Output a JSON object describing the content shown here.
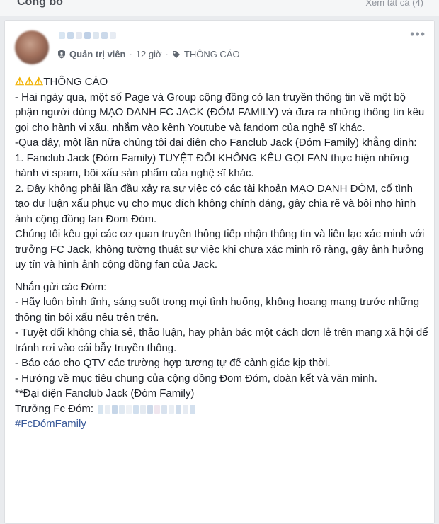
{
  "header": {
    "title": "Công bố",
    "see_all": "Xem tất cả (4)"
  },
  "post": {
    "role": "Quản trị viên",
    "time": "12 giờ",
    "tag": "THÔNG CÁO",
    "headline_icons": "⚠⚠⚠",
    "headline": "THÔNG CÁO",
    "paragraphs": [
      "- Hai ngày qua, một số Page và Group cộng đồng có lan truyền thông tin về một bộ phận người dùng MẠO DANH FC JACK (ĐÓM FAMILY) và đưa ra những thông tin kêu gọi cho hành vi xấu, nhắm vào kênh Youtube và fandom của nghệ sĩ khác.",
      "-Qua đây, một lần nữa chúng tôi đại diện cho Fanclub Jack (Đóm Family) khẳng định:",
      "1. Fanclub Jack (Đóm Family) TUYỆT ĐỐI KHÔNG KÊU GỌI FAN thực hiện những hành vi spam, bôi xấu sản phẩm của nghệ sĩ khác.",
      "2. Đây không phải lần đầu xảy ra sự việc có các tài khoản MẠO DANH ĐÓM, cố tình tạo dư luận xấu phục vụ cho mục đích không chính đáng, gây chia rẽ và bôi nhọ hình ảnh cộng đồng fan Đom Đóm.",
      "Chúng tôi kêu gọi các cơ quan truyền thông tiếp nhận thông tin và liên lạc xác minh với trưởng FC Jack, không tường thuật sự việc khi chưa xác minh rõ ràng, gây ảnh hưởng uy tín và hình ảnh cộng đồng fan của Jack."
    ],
    "paragraphs2": [
      "Nhắn gửi các Đóm:",
      "- Hãy luôn bình tĩnh, sáng suốt trong mọi tình huống, không hoang mang trước những thông tin bôi xấu nêu trên trên.",
      "- Tuyệt đối không chia sẻ, thảo luận, hay phản bác một cách đơn lẻ trên mạng xã hội để tránh rơi vào cái bẫy truyền thông.",
      "- Báo cáo cho QTV các trường hợp tương tự để cảnh giác kịp thời.",
      "- Hướng về mục tiêu chung của cộng đồng Đom Đóm, đoàn kết và văn minh.",
      "**Đại diện Fanclub Jack (Đóm Family)"
    ],
    "signature_label": "Trưởng Fc Đóm:",
    "hashtag": "#FcĐómFamily"
  },
  "icons": {
    "role_icon": "shield-icon",
    "tag_icon": "tag-icon",
    "more_icon": "more-icon"
  },
  "colors": {
    "link": "#385898",
    "warning": "#f2b200",
    "page_bg": "#e9ebee"
  }
}
